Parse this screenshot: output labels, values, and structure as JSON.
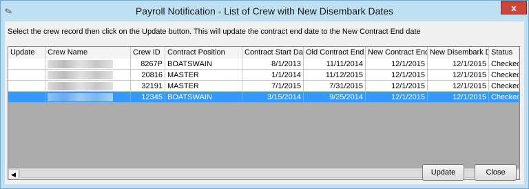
{
  "window": {
    "title": "Payroll Notification - List of Crew with New Disembark Dates",
    "close_label": "x"
  },
  "instructions": "Select the crew record then click on the Update button. This will update the contract end date to the New Contract End date",
  "grid": {
    "columns": [
      "Update",
      "Crew Name",
      "Crew ID",
      "Contract Position",
      "Contract Start Date",
      "Old Contract End",
      "New Contract End",
      "New Disembark Date",
      "Status"
    ],
    "rows": [
      {
        "update": "",
        "crew_name": "",
        "crew_id": "8267P",
        "position": "BOATSWAIN",
        "start": "8/1/2013",
        "old_end": "11/11/2014",
        "new_end": "12/1/2015",
        "disembark": "12/1/2015",
        "status": "Checked-In",
        "selected": false
      },
      {
        "update": "",
        "crew_name": "",
        "crew_id": "20816",
        "position": "MASTER",
        "start": "1/1/2014",
        "old_end": "11/12/2015",
        "new_end": "12/1/2015",
        "disembark": "12/1/2015",
        "status": "Checked-In",
        "selected": false
      },
      {
        "update": "",
        "crew_name": "",
        "crew_id": "32191",
        "position": "MASTER",
        "start": "7/1/2015",
        "old_end": "7/31/2015",
        "new_end": "12/1/2015",
        "disembark": "12/1/2015",
        "status": "Checked-In",
        "selected": false
      },
      {
        "update": "",
        "crew_name": "",
        "crew_id": "12345",
        "position": "BOATSWAIN",
        "start": "3/15/2014",
        "old_end": "9/25/2014",
        "new_end": "12/1/2015",
        "disembark": "12/1/2015",
        "status": "Checked-In",
        "selected": true
      }
    ]
  },
  "scrollbar": {
    "left_arrow": "◀",
    "right_arrow": "▶"
  },
  "buttons": {
    "update": "Update",
    "close": "Close"
  }
}
